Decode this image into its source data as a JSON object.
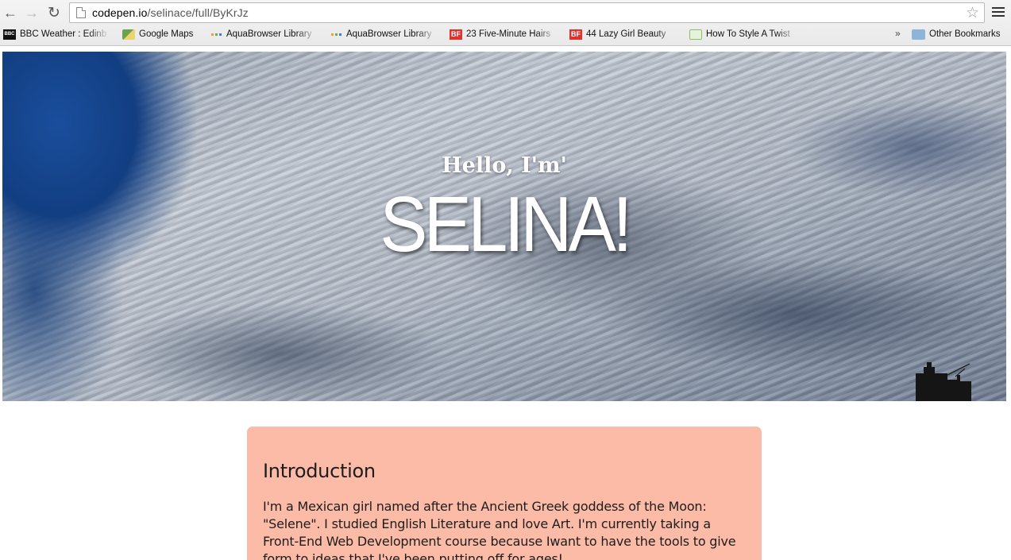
{
  "browser": {
    "url_host": "codepen.io",
    "url_path": "/selinace/full/ByKrJz",
    "bookmarks": [
      {
        "label": "BBC Weather : Edinb",
        "icon": "bbc-icon"
      },
      {
        "label": "Google Maps",
        "icon": "google-maps-icon"
      },
      {
        "label": "AquaBrowser Library",
        "icon": "aquabrowser-icon"
      },
      {
        "label": "AquaBrowser Library",
        "icon": "aquabrowser-icon"
      },
      {
        "label": "23 Five-Minute Hairs",
        "icon": "buzzfeed-icon"
      },
      {
        "label": "44 Lazy Girl Beauty",
        "icon": "buzzfeed-icon"
      },
      {
        "label": "How To Style A Twist",
        "icon": "twist-icon"
      }
    ],
    "more_label": "»",
    "other_bookmarks": "Other Bookmarks"
  },
  "hero": {
    "greeting": "Hello, I'm'",
    "name": "SELINA!"
  },
  "intro": {
    "heading": "Introduction",
    "body": "I'm a Mexican girl named after the Ancient Greek goddess of the Moon: \"Selene\". I studied English Literature and love Art. I'm currently taking a Front-End Web Development course because Iwant to have the tools to give form to ideas that I've been putting off for ages!"
  },
  "colors": {
    "card_background": "#fbbba6",
    "hero_text": "#ffffff"
  }
}
